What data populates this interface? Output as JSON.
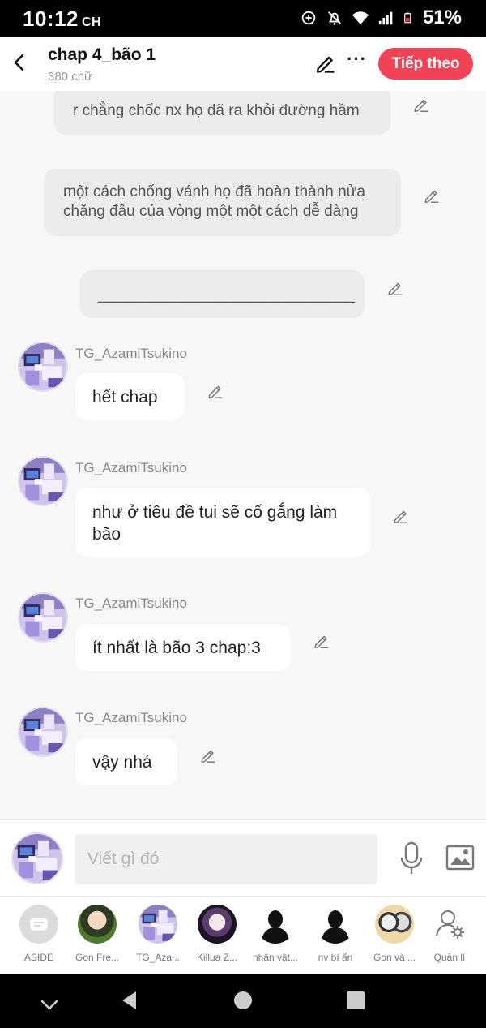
{
  "status": {
    "time": "10:12",
    "ampm": "CH",
    "battery": "51%"
  },
  "header": {
    "title": "chap 4_bão 1",
    "subtitle": "380 chữ",
    "next_label": "Tiếp theo"
  },
  "messages": [
    {
      "type": "narration",
      "text": "r chẳng chốc nx họ đã ra khỏi đường hầm"
    },
    {
      "type": "narration",
      "text": "một cách chống vánh họ đã hoàn thành nửa chặng đầu của vòng một một cách dễ dàng"
    },
    {
      "type": "narration",
      "text": "______________________________"
    },
    {
      "type": "chat",
      "user": "TG_AzamiTsukino",
      "text": "hết chap"
    },
    {
      "type": "chat",
      "user": "TG_AzamiTsukino",
      "text": "như ở tiêu đề tui sẽ cố gắng làm bão"
    },
    {
      "type": "chat",
      "user": "TG_AzamiTsukino",
      "text": "ít nhất là bão 3 chap:3"
    },
    {
      "type": "chat",
      "user": "TG_AzamiTsukino",
      "text": "vậy nhá"
    }
  ],
  "composer": {
    "placeholder": "Viết gì đó"
  },
  "characters": [
    {
      "label": "ASIDE"
    },
    {
      "label": "Gon Fre..."
    },
    {
      "label": "TG_Aza..."
    },
    {
      "label": "Killua Z..."
    },
    {
      "label": "nhân vật..."
    },
    {
      "label": "nv bí ẩn"
    },
    {
      "label": "Gon và ..."
    },
    {
      "label": "Quản lí"
    }
  ],
  "colors": {
    "accent": "#f14356",
    "bubble_narration": "#ececec",
    "bubble_chat": "#ffffff",
    "background": "#f7f7f7"
  }
}
